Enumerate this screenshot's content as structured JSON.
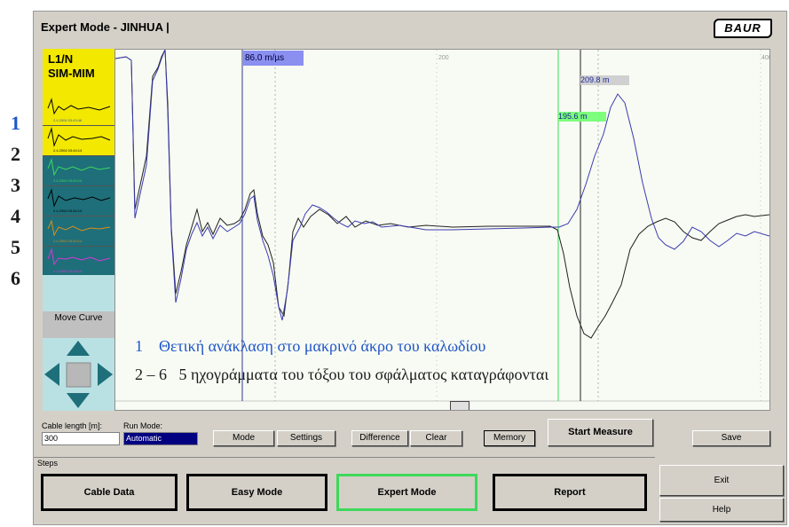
{
  "window": {
    "title": "Expert Mode - JINHUA  |",
    "logo": "BAUR"
  },
  "row_numbers": [
    "1",
    "2",
    "3",
    "4",
    "5",
    "6"
  ],
  "side_panel": {
    "heading_line1": "L1/N",
    "heading_line2": "SIM-MIM",
    "traces": [
      {
        "timestamp": "2.4.2004 03:43:46",
        "bg": "#f2e800",
        "line": "#000000",
        "ts_color": "#3355aa"
      },
      {
        "timestamp": "2.4.2004 03:44:14",
        "bg": "#f2e800",
        "line": "#000000",
        "ts_color": "#000000"
      },
      {
        "timestamp": "2.4.2004 03:44:14",
        "bg": "#1e6f7a",
        "line": "#3ed85a",
        "ts_color": "#3ed85a"
      },
      {
        "timestamp": "2.4.2004 03:44:14",
        "bg": "#1e6f7a",
        "line": "#000000",
        "ts_color": "#000000"
      },
      {
        "timestamp": "2.4.2004 03:44:14",
        "bg": "#1e6f7a",
        "line": "#d98f1a",
        "ts_color": "#d98f1a"
      },
      {
        "timestamp": "2.4.2004 03:44:14",
        "bg": "#1e6f7a",
        "line": "#d63ad6",
        "ts_color": "#d63ad6"
      }
    ],
    "move_curve": "Move Curve"
  },
  "plot": {
    "velocity_label": "86.0 m/µs",
    "marker_green_label": "195.6 m",
    "marker_black_label": "209.8 m",
    "tick_200": "200",
    "tick_400": "400",
    "annotation_line1_num": "1",
    "annotation_line1_text": "Θετική ανάκλαση στο μακρινό άκρο του καλωδίου",
    "annotation_line2_num": "2 – 6",
    "annotation_line2_text": "5 ηχογράμματα του τόξου του σφάλματος καταγράφονται",
    "colors": {
      "blue_curve": "#3b3bb0",
      "black_curve": "#202020",
      "green_marker": "#3ed85a",
      "cursor_blue": "#2a3a9a"
    }
  },
  "controls": {
    "cable_length_label": "Cable length [m]:",
    "cable_length_value": "300",
    "run_mode_label": "Run Mode:",
    "run_mode_value": "Automatic",
    "buttons": [
      "Mode",
      "Settings",
      "Difference",
      "Clear",
      "Memory"
    ],
    "start_measure": "Start Measure",
    "save": "Save"
  },
  "steps": {
    "label": "Steps",
    "cable_data": "Cable Data",
    "easy_mode": "Easy Mode",
    "expert_mode": "Expert Mode",
    "report": "Report",
    "exit": "Exit",
    "help": "Help"
  }
}
